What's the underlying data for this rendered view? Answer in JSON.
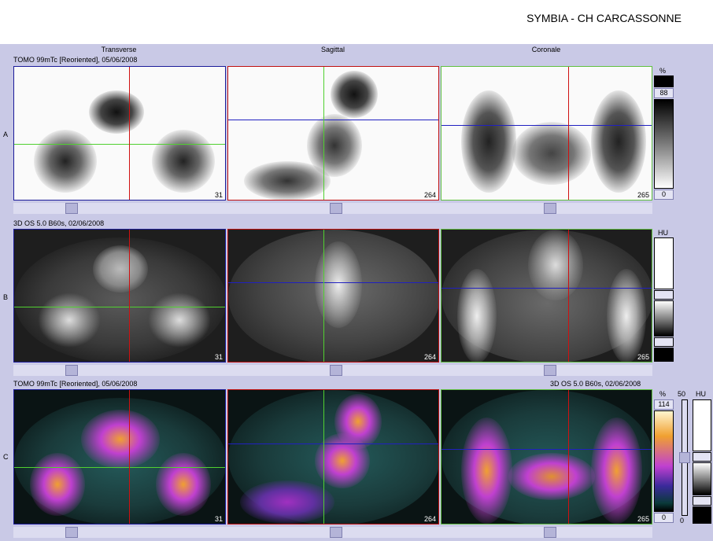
{
  "header": {
    "title": "SYMBIA - CH CARCASSONNE"
  },
  "columns": [
    "Transverse",
    "Sagittal",
    "Coronale"
  ],
  "rows": {
    "a": {
      "label": "A",
      "info": "TOMO 99mTc [Reoriented], 05/06/2008",
      "slices": [
        "31",
        "264",
        "265"
      ]
    },
    "b": {
      "label": "B",
      "info": "3D  OS  5.0  B60s, 02/06/2008",
      "slices": [
        "31",
        "264",
        "265"
      ]
    },
    "c": {
      "label": "C",
      "info_left": "TOMO 99mTc [Reoriented], 05/06/2008",
      "info_right": "3D  OS  5.0  B60s, 02/06/2008",
      "slices": [
        "31",
        "264",
        "265"
      ]
    }
  },
  "scales": {
    "a": {
      "unit": "%",
      "top": "88",
      "bottom": "0"
    },
    "b": {
      "unit": "HU"
    },
    "c": {
      "unit_left": "%",
      "top": "114",
      "bottom": "0",
      "mid_top": "50",
      "mid_bottom": "0",
      "unit_right": "HU"
    }
  },
  "colors": {
    "crosshair_red": "#d01010",
    "crosshair_green": "#50d030",
    "crosshair_blue": "#2020c0",
    "panel_border_blue": "#1c1c9a",
    "background": "#c9c9e6"
  }
}
